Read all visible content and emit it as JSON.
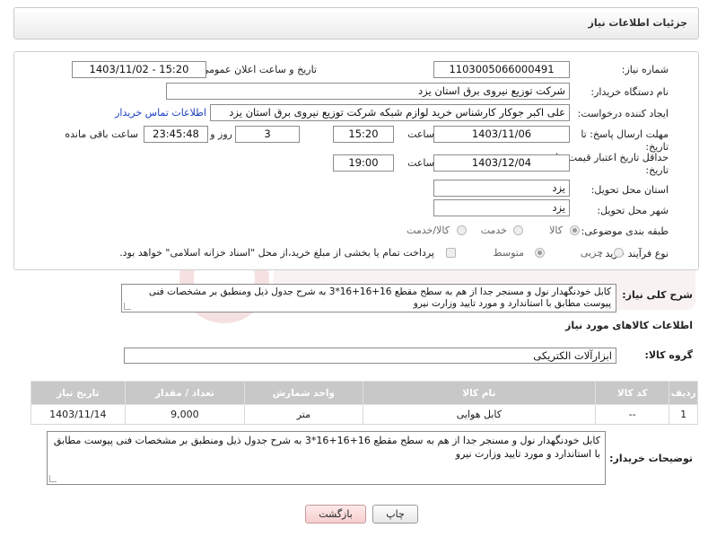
{
  "header": {
    "title": "جزئیات اطلاعات نیاز"
  },
  "form": {
    "need_number": {
      "label": "شماره نیاز:",
      "value": "1103005066000491"
    },
    "announce": {
      "label": "تاریخ و ساعت اعلان عمومی:",
      "value": "1403/11/02 - 15:20"
    },
    "buyer": {
      "label": "نام دستگاه خریدار:",
      "value": "شرکت توزیع نیروی برق استان یزد"
    },
    "creator": {
      "label": "ایجاد کننده درخواست:",
      "value": "علی اکبر  جوکار  کارشناس خرید لوازم شبکه  شرکت توزیع نیروی برق استان یزد",
      "contact_link": "اطلاعات تماس خریدار"
    },
    "reply_deadline": {
      "label_line1": "مهلت ارسال پاسخ: تا",
      "label_line2": "تاریخ:",
      "date": "1403/11/06",
      "time_label": "ساعت",
      "time": "15:20",
      "days": "3",
      "days_label": "روز و",
      "remaining": "23:45:48",
      "remaining_label": "ساعت باقی مانده"
    },
    "price_validity": {
      "label_line1": "حداقل تاریخ اعتبار قیمت: تا",
      "label_line2": "تاریخ:",
      "date": "1403/12/04",
      "time_label": "ساعت",
      "time": "19:00"
    },
    "province": {
      "label": "استان محل تحویل:",
      "value": "یزد"
    },
    "city": {
      "label": "شهر محل تحویل:",
      "value": "یزد"
    },
    "category": {
      "label": "طبقه بندی موضوعی:",
      "options": [
        "کالا",
        "خدمت",
        "کالا/خدمت"
      ],
      "selected": "کالا"
    },
    "purchase_type": {
      "label": "نوع فرآیند خرید :",
      "options": [
        "جزیی",
        "متوسط"
      ],
      "selected": "متوسط",
      "payment_note": "پرداخت تمام یا بخشی از مبلغ خرید،از محل \"اسناد خزانه اسلامی\" خواهد بود."
    }
  },
  "summary": {
    "label": "شرح کلی نیاز:",
    "text": "کابل خودنگهدار نول و مسنجر جدا از هم به سطح مقطع  16+16+16*3 به شرح جدول ذیل ومنطبق بر  مشخصات فنی پیوست مطابق با استاندارد و مورد تایید وزارت نیرو"
  },
  "goods": {
    "section_title": "اطلاعات کالاهای مورد نیاز",
    "group_label": "گروه کالا:",
    "group_value": "ابزارآلات الکتریکی",
    "columns": [
      "ردیف",
      "کد کالا",
      "نام کالا",
      "واحد شمارش",
      "تعداد / مقدار",
      "تاریخ نیاز"
    ],
    "rows": [
      [
        "1",
        "--",
        "کابل هوایی",
        "متر",
        "9,000",
        "1403/11/14"
      ]
    ]
  },
  "buyer_notes": {
    "label": "توضیحات خریدار:",
    "text": "کابل خودنگهدار نول و مسنجر جدا از هم به سطح مقطع  16+16+16*3 به شرح جدول ذیل ومنطبق بر  مشخصات فنی پیوست مطابق با استاندارد و مورد تایید وزارت نیرو"
  },
  "buttons": {
    "print": "چاپ",
    "back": "بازگشت"
  },
  "colors": {
    "link": "#1a3fc0",
    "table_header": "#c8c8c8",
    "back_button": "#f6cfcf"
  }
}
